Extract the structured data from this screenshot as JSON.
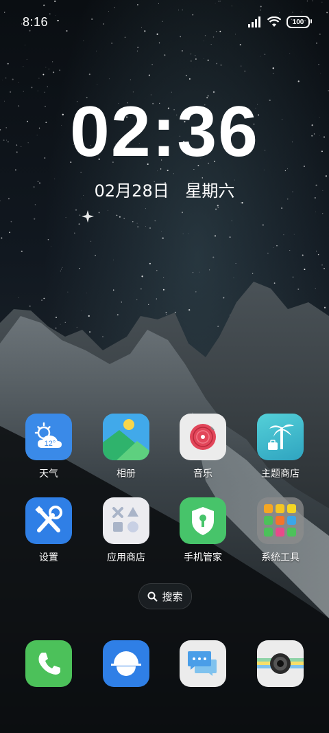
{
  "status_bar": {
    "time": "8:16",
    "battery_level": "100",
    "signal_icon": "signal-icon",
    "wifi_icon": "wifi-icon"
  },
  "lock_widget": {
    "clock": "02:36",
    "date": "02月28日",
    "weekday": "星期六"
  },
  "apps_row1": [
    {
      "label": "天气",
      "icon": "weather-icon",
      "temp": "12°"
    },
    {
      "label": "相册",
      "icon": "gallery-icon"
    },
    {
      "label": "音乐",
      "icon": "music-icon"
    },
    {
      "label": "主题商店",
      "icon": "theme-store-icon"
    }
  ],
  "apps_row2": [
    {
      "label": "设置",
      "icon": "settings-icon"
    },
    {
      "label": "应用商店",
      "icon": "app-store-icon"
    },
    {
      "label": "手机管家",
      "icon": "phone-manager-icon"
    },
    {
      "label": "系统工具",
      "icon": "system-tools-folder-icon"
    }
  ],
  "search": {
    "label": "搜索",
    "icon": "search-icon"
  },
  "dock": [
    {
      "icon": "phone-icon"
    },
    {
      "icon": "browser-icon"
    },
    {
      "icon": "messages-icon"
    },
    {
      "icon": "camera-icon"
    }
  ],
  "colors": {
    "weather_bg": "#3a8ae8",
    "settings_bg": "#2f7fe6",
    "phone_bg": "#4cc15a",
    "browser_bg": "#2f7fe6",
    "manager_bg": "#47c46a",
    "theme_bg": "#3cbcc8"
  }
}
